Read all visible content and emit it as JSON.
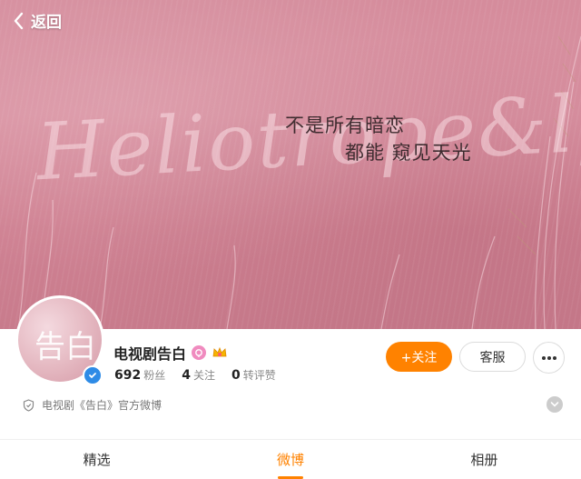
{
  "nav": {
    "back_label": "返回",
    "back_icon": "chevron-left-icon"
  },
  "cover": {
    "watermark": "Heliotrope&lgz",
    "tagline_1": "不是所有暗恋",
    "tagline_2": "都能    窥见天光"
  },
  "profile": {
    "avatar_glyph": "告白",
    "name": "电视剧告白",
    "badge_p_icon": "p-badge-icon",
    "badge_crown_icon": "crown-badge-icon",
    "verified_icon": "verified-check-icon",
    "stats": [
      {
        "value": "692",
        "label": "粉丝"
      },
      {
        "value": "4",
        "label": "关注"
      },
      {
        "value": "0",
        "label": "转评赞"
      }
    ],
    "follow_label": "+关注",
    "service_label": "客服",
    "more_icon": "more-dots-icon",
    "description": "电视剧《告白》官方微博",
    "description_icon": "shield-icon",
    "expand_icon": "chevron-down-icon"
  },
  "tabs": [
    {
      "label": "精选",
      "active": false
    },
    {
      "label": "微博",
      "active": true
    },
    {
      "label": "相册",
      "active": false
    }
  ],
  "colors": {
    "accent": "#ff8200",
    "cover_pink": "#d58c9c",
    "verified_blue": "#2e8be6"
  }
}
